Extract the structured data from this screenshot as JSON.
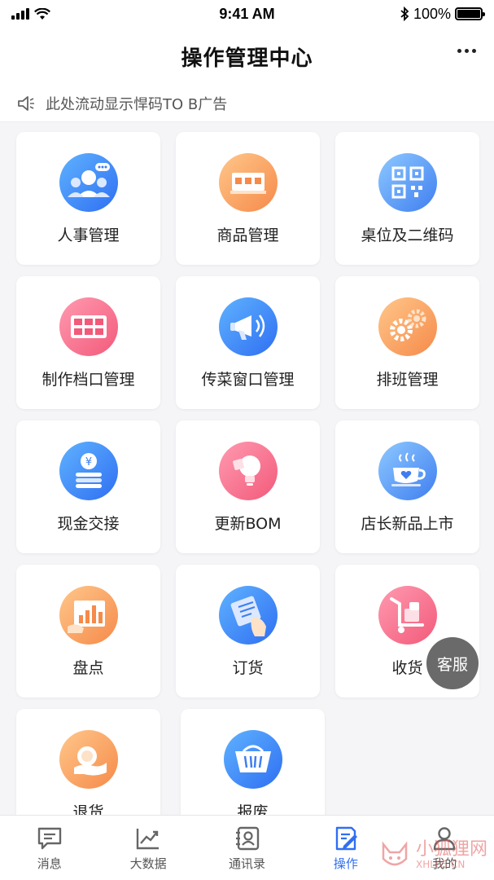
{
  "status_bar": {
    "time": "9:41 AM",
    "battery": "100%"
  },
  "nav": {
    "title": "操作管理中心",
    "more_icon": "more-icon"
  },
  "notice": {
    "icon": "speaker-icon",
    "text": "此处流动显示悍码TO B广告"
  },
  "cards": [
    {
      "label": "人事管理",
      "icon": "people-icon",
      "color": "#3f7ef0"
    },
    {
      "label": "商品管理",
      "icon": "shop-icon",
      "color": "#f58a4a"
    },
    {
      "label": "桌位及二维码",
      "icon": "qrcode-icon",
      "color": "#3f7ef0"
    },
    {
      "label": "制作档口管理",
      "icon": "grid-panel-icon",
      "color": "#f25a7a"
    },
    {
      "label": "传菜窗口管理",
      "icon": "megaphone-icon",
      "color": "#3f7ef0"
    },
    {
      "label": "排班管理",
      "icon": "gears-icon",
      "color": "#f58a4a"
    },
    {
      "label": "现金交接",
      "icon": "coins-icon",
      "color": "#3f7ef0"
    },
    {
      "label": "更新BOM",
      "icon": "bulb-icon",
      "color": "#f25a7a"
    },
    {
      "label": "店长新品上市",
      "icon": "cup-icon",
      "color": "#3f7ef0"
    },
    {
      "label": "盘点",
      "icon": "chart-board-icon",
      "color": "#f58a4a"
    },
    {
      "label": "订货",
      "icon": "order-hand-icon",
      "color": "#3f7ef0"
    },
    {
      "label": "收货",
      "icon": "cart-icon",
      "color": "#f25a7a"
    },
    {
      "label": "退货",
      "icon": "coin-hand-icon",
      "color": "#f58a4a"
    },
    {
      "label": "报废",
      "icon": "basket-icon",
      "color": "#3f7ef0"
    }
  ],
  "float_service": {
    "label": "客服"
  },
  "tabs": [
    {
      "label": "消息",
      "icon": "message-icon",
      "active": false
    },
    {
      "label": "大数据",
      "icon": "trend-icon",
      "active": false
    },
    {
      "label": "通讯录",
      "icon": "contacts-icon",
      "active": false
    },
    {
      "label": "操作",
      "icon": "edit-icon",
      "active": true
    },
    {
      "label": "我的",
      "icon": "user-icon",
      "active": false
    }
  ],
  "watermark": {
    "text": "小狐狸网",
    "sub": "XHL65.CN"
  }
}
